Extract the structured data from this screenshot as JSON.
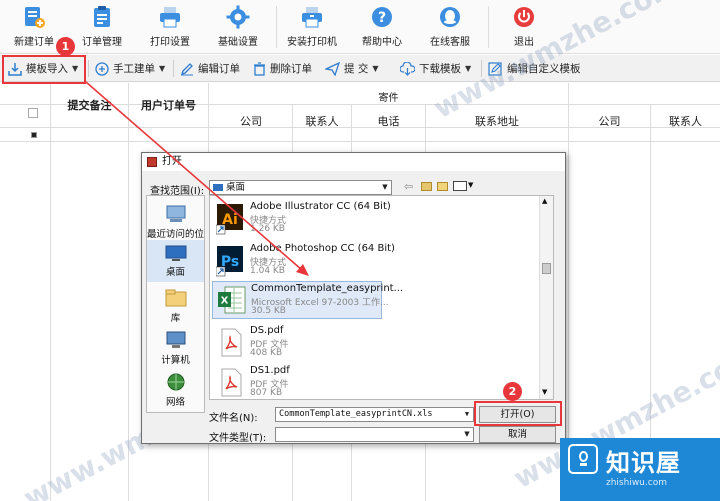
{
  "toolbar": {
    "items": [
      {
        "label": "新建订单",
        "icon": "new-order-icon"
      },
      {
        "label": "订单管理",
        "icon": "clipboard-icon"
      },
      {
        "label": "打印设置",
        "icon": "printer-icon"
      },
      {
        "label": "基础设置",
        "icon": "gear-icon"
      },
      {
        "label": "安装打印机",
        "icon": "install-printer-icon"
      },
      {
        "label": "帮助中心",
        "icon": "help-icon"
      },
      {
        "label": "在线客服",
        "icon": "support-icon"
      },
      {
        "label": "退出",
        "icon": "power-icon"
      }
    ]
  },
  "subbar": {
    "template_import": "模板导入",
    "manual_order": "手工建单",
    "edit_order": "编辑订单",
    "delete_order": "删除订单",
    "submit": "提 交",
    "download_template": "下载模板",
    "edit_custom_template": "编辑自定义模板"
  },
  "grid": {
    "col_remark": "提交备注",
    "col_user_order": "用户订单号",
    "group_sender": "寄件",
    "sub_company": "公司",
    "sub_contact": "联系人",
    "sub_phone": "电话",
    "sub_address": "联系地址",
    "sub_company2": "公司",
    "sub_contact2": "联系人"
  },
  "dialog": {
    "title": "打开",
    "lookin_label": "查找范围(I):",
    "lookin_value": "桌面",
    "places": [
      "最近访问的位置",
      "桌面",
      "库",
      "计算机",
      "网络"
    ],
    "files": [
      {
        "name": "Adobe Illustrator CC (64 Bit)",
        "type": "快捷方式",
        "size": "1.26 KB",
        "icon": "illustrator-icon"
      },
      {
        "name": "Adobe Photoshop CC (64 Bit)",
        "type": "快捷方式",
        "size": "1.04 KB",
        "icon": "photoshop-icon"
      },
      {
        "name": "CommonTemplate_easyprint...",
        "type": "Microsoft Excel 97-2003 工作...",
        "size": "30.5 KB",
        "icon": "excel-icon"
      },
      {
        "name": "DS.pdf",
        "type": "PDF 文件",
        "size": "408 KB",
        "icon": "pdf-icon"
      },
      {
        "name": "DS1.pdf",
        "type": "PDF 文件",
        "size": "807 KB",
        "icon": "pdf-icon"
      }
    ],
    "filename_label": "文件名(N):",
    "filename_value": "CommonTemplate_easyprintCN.xls",
    "filetype_label": "文件类型(T):",
    "filetype_value": "",
    "open_button": "打开(O)",
    "cancel_button": "取消"
  },
  "annotations": {
    "step1": "1",
    "step2": "2",
    "color": "#e8373b"
  },
  "watermark": {
    "text": "www.wmzhe.com"
  },
  "brand": {
    "name": "知识屋",
    "url": "zhishiwu.com"
  }
}
